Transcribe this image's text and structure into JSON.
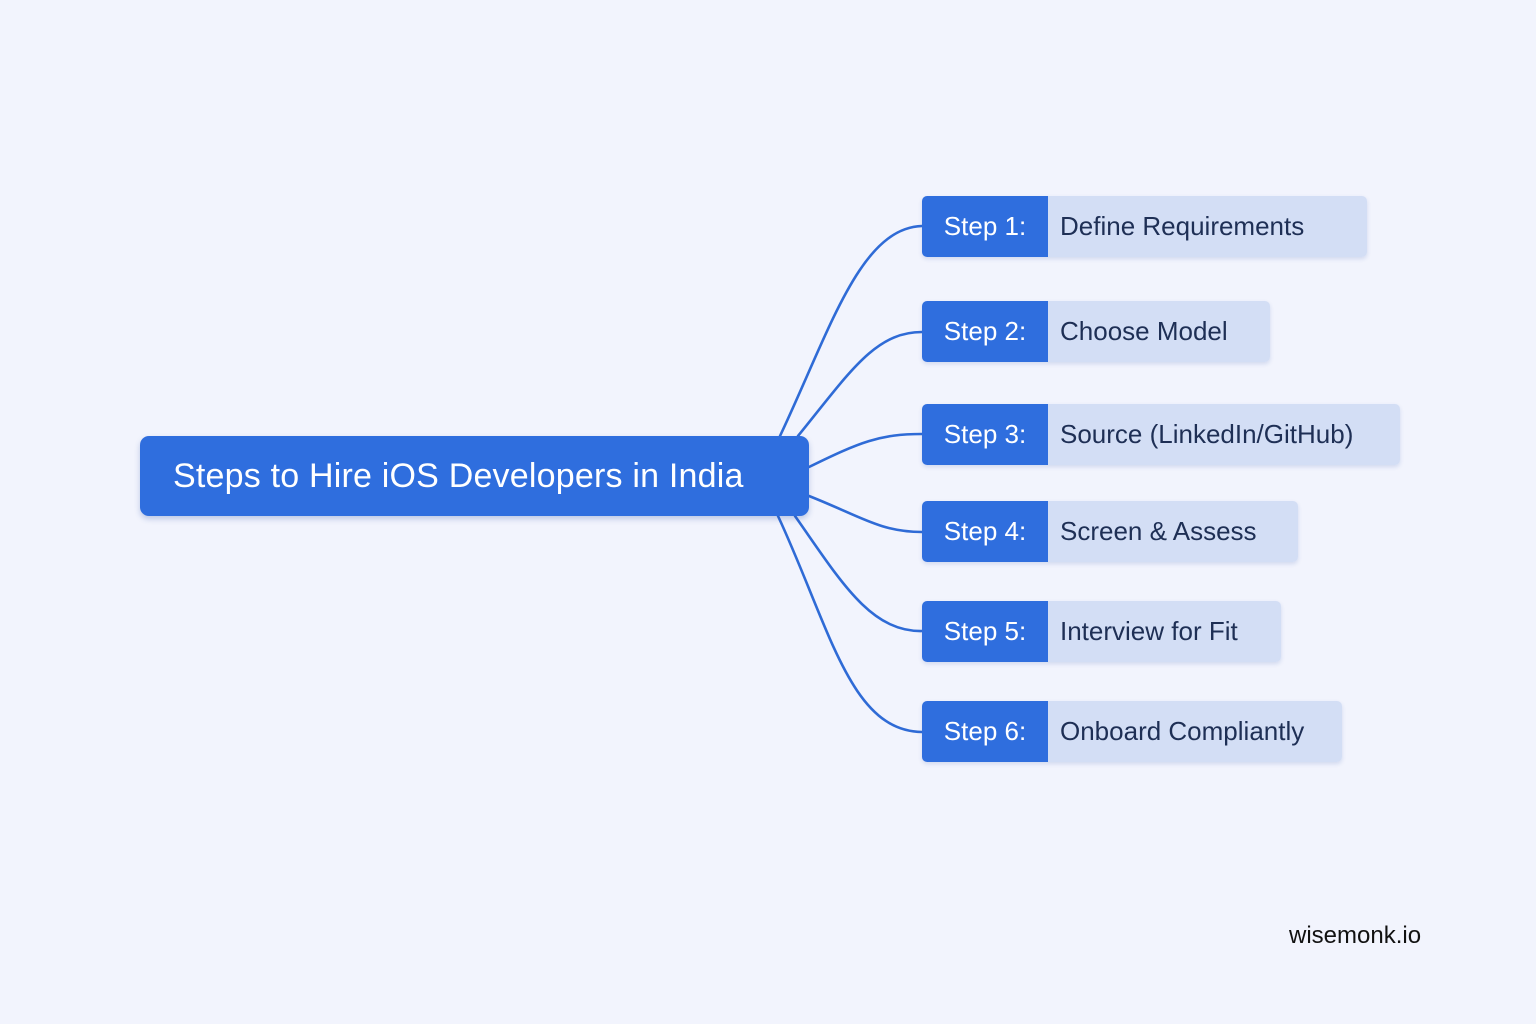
{
  "diagram": {
    "root": {
      "label": "Steps to Hire iOS Developers in India"
    },
    "steps": [
      {
        "tag": "Step 1:",
        "title": "Define Requirements"
      },
      {
        "tag": "Step 2:",
        "title": "Choose Model"
      },
      {
        "tag": "Step 3:",
        "title": "Source (LinkedIn/GitHub)"
      },
      {
        "tag": "Step 4:",
        "title": "Screen & Assess"
      },
      {
        "tag": "Step 5:",
        "title": "Interview for Fit"
      },
      {
        "tag": "Step 6:",
        "title": "Onboard Compliantly"
      }
    ]
  },
  "brand": {
    "label": "wisemonk.io"
  },
  "colors": {
    "background": "#f2f4fd",
    "accent": "#2f6ede",
    "title_fill": "#d3def5",
    "connector": "#2f6bd6"
  }
}
